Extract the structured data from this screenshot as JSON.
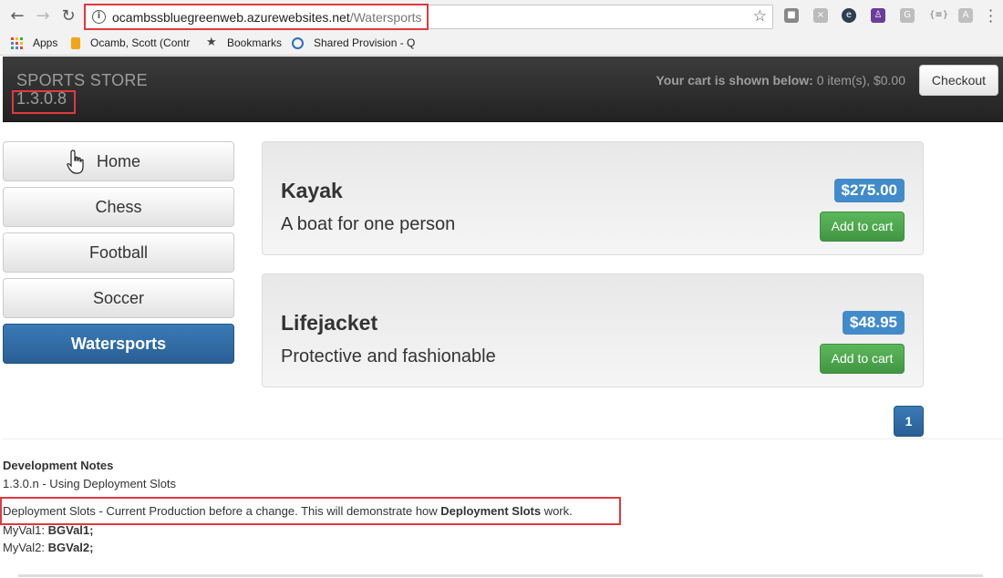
{
  "browser": {
    "url_host": "ocambssbluegreenweb.azurewebsites.net",
    "url_path": "/Watersports",
    "bookmarks": [
      {
        "label": "Apps"
      },
      {
        "label": "Ocamb, Scott (Contr"
      },
      {
        "label": "Bookmarks"
      },
      {
        "label": "Shared Provision - Q"
      }
    ]
  },
  "navbar": {
    "brand": "SPORTS STORE",
    "version": "1.3.0.8",
    "cart_label": "Your cart is shown below:",
    "cart_summary": "0 item(s), $0.00",
    "checkout_label": "Checkout"
  },
  "categories": [
    {
      "label": "Home"
    },
    {
      "label": "Chess"
    },
    {
      "label": "Football"
    },
    {
      "label": "Soccer"
    },
    {
      "label": "Watersports",
      "active": true
    }
  ],
  "products": [
    {
      "name": "Kayak",
      "description": "A boat for one person",
      "price": "$275.00",
      "button": "Add to cart"
    },
    {
      "name": "Lifejacket",
      "description": "Protective and fashionable",
      "price": "$48.95",
      "button": "Add to cart"
    }
  ],
  "pagination": {
    "current": "1"
  },
  "notes": {
    "heading": "Development Notes",
    "version_line": "1.3.0.n - Using Deployment Slots",
    "slots_prefix": "Deployment Slots - Current Production before a change. This will demonstrate how ",
    "slots_bold": "Deployment Slots",
    "slots_suffix": " work.",
    "val1_label": "MyVal1: ",
    "val1_value": "BGVal1;",
    "val2_label": "MyVal2: ",
    "val2_value": "BGVal2;"
  },
  "colors": {
    "primary": "#428bca",
    "success": "#5cb85c",
    "highlight": "#e0393e"
  }
}
